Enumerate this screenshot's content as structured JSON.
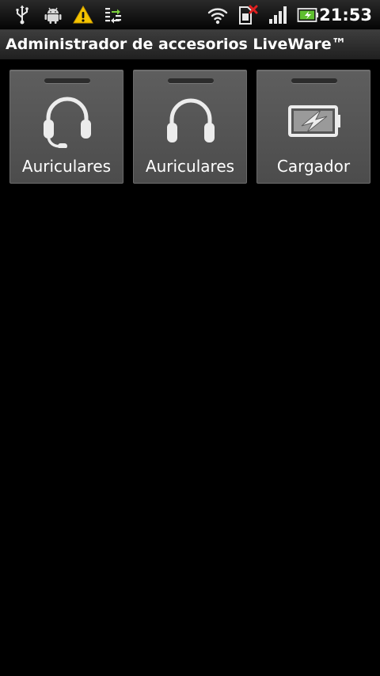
{
  "status_bar": {
    "time": "21:53",
    "icons": [
      "usb-icon",
      "android-icon",
      "warning-icon",
      "data-sync-icon",
      "wifi-icon",
      "sim-missing-icon",
      "signal-icon",
      "battery-charging-icon"
    ],
    "colors": {
      "warning": "#f5c400",
      "sim_error": "#e02020",
      "battery": "#5fbf2f",
      "data_sync": "#7ccf3c"
    }
  },
  "title_bar": {
    "title": "Administrador de accesorios LiveWare™"
  },
  "tiles": [
    {
      "label": "Auriculares",
      "icon": "headset-with-mic-icon"
    },
    {
      "label": "Auriculares",
      "icon": "headphones-icon"
    },
    {
      "label": "Cargador",
      "icon": "charger-battery-icon"
    }
  ]
}
